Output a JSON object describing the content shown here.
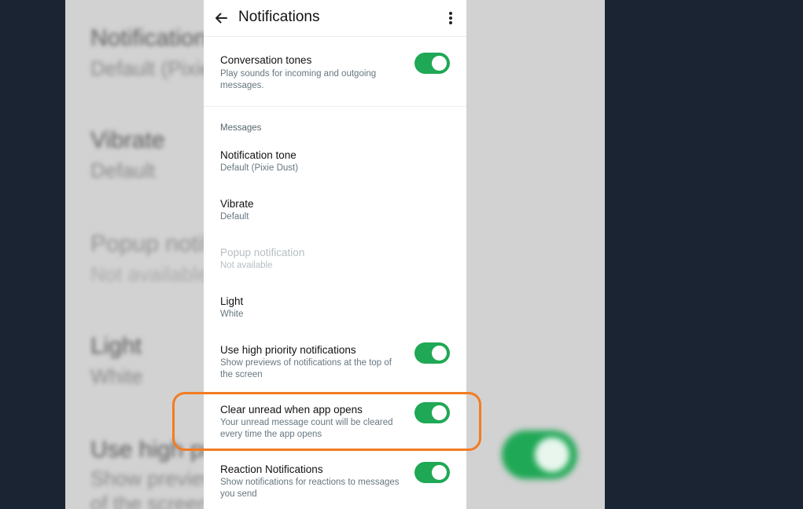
{
  "backdrop": {
    "texts": [
      {
        "text": "Notification",
        "style": "title"
      },
      {
        "text": "Default (Pixie",
        "style": "sub"
      },
      {
        "text": "Vibrate",
        "style": "title"
      },
      {
        "text": "Default",
        "style": "sub"
      },
      {
        "text": "Popup notific",
        "style": "title"
      },
      {
        "text": "Not available",
        "style": "sub"
      },
      {
        "text": "Light",
        "style": "title"
      },
      {
        "text": "White",
        "style": "sub"
      },
      {
        "text": "Use high pri",
        "style": "title"
      },
      {
        "text": "Show previews",
        "style": "sub"
      },
      {
        "text": "of the screen",
        "style": "sub"
      }
    ]
  },
  "appbar": {
    "title": "Notifications",
    "back_icon": "arrow-left-icon",
    "menu_icon": "more-vert-icon"
  },
  "conversation_tones": {
    "title": "Conversation tones",
    "subtitle": "Play sounds for incoming and outgoing messages.",
    "enabled": true
  },
  "messages_section": {
    "label": "Messages",
    "notification_tone": {
      "title": "Notification tone",
      "subtitle": "Default (Pixie Dust)"
    },
    "vibrate": {
      "title": "Vibrate",
      "subtitle": "Default"
    },
    "popup_notification": {
      "title": "Popup notification",
      "subtitle": "Not available",
      "disabled": true
    },
    "light": {
      "title": "Light",
      "subtitle": "White"
    },
    "high_priority": {
      "title": "Use high priority notifications",
      "subtitle": "Show previews of notifications at the top of the screen",
      "enabled": true
    },
    "clear_unread": {
      "title": "Clear unread when app opens",
      "subtitle": "Your unread message count will be cleared every time the app opens",
      "enabled": true,
      "highlighted": true
    },
    "reaction_notifications": {
      "title": "Reaction Notifications",
      "subtitle": "Show notifications for reactions to messages you send",
      "enabled": true
    }
  },
  "colors": {
    "toggle_on": "#1fa855",
    "highlight": "#f27c22",
    "outer_background": "#1b2433"
  }
}
